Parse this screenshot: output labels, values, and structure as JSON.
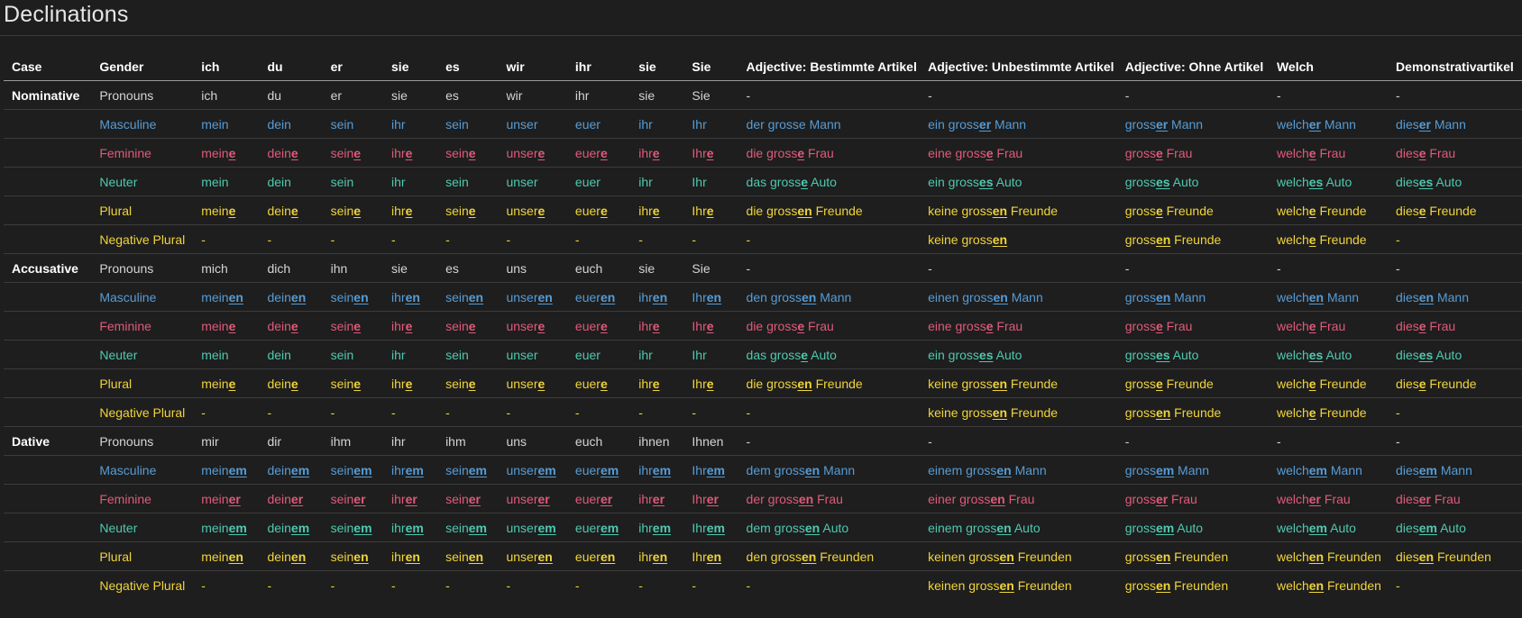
{
  "title": "Declinations",
  "colors": {
    "background": "#1e1e1e",
    "text": "#d4d4d4",
    "masculine": "#569cd6",
    "feminine": "#e05a7a",
    "neuter": "#4ec9b0",
    "plural": "#f0d43a"
  },
  "headers": [
    "Case",
    "Gender",
    "ich",
    "du",
    "er",
    "sie",
    "es",
    "wir",
    "ihr",
    "sie",
    "Sie",
    "Adjective: Bestimmte Artikel",
    "Adjective: Unbestimmte Artikel",
    "Adjective: Ohne Artikel",
    "Welch",
    "Demonstrativartikel"
  ],
  "rows": [
    {
      "case": "Nominative",
      "color": "none",
      "gender": "Pronouns",
      "cells": [
        "ich",
        "du",
        "er",
        "sie",
        "es",
        "wir",
        "ihr",
        "sie",
        "Sie",
        "-",
        "-",
        "-",
        "-",
        "-"
      ]
    },
    {
      "case": "",
      "color": "blue",
      "gender": "Masculine",
      "cells": [
        "mein",
        "dein",
        "sein",
        "ihr",
        "sein",
        "unser",
        "euer",
        "ihr",
        "Ihr",
        "der grosse Mann",
        "ein gross[er] Mann",
        "gross[er] Mann",
        "welch[er] Mann",
        "dies[er] Mann"
      ]
    },
    {
      "case": "",
      "color": "pink",
      "gender": "Feminine",
      "cells": [
        "mein[e]",
        "dein[e]",
        "sein[e]",
        "ihr[e]",
        "sein[e]",
        "unser[e]",
        "euer[e]",
        "ihr[e]",
        "Ihr[e]",
        "die gross[e] Frau",
        "eine gross[e] Frau",
        "gross[e] Frau",
        "welch[e] Frau",
        "dies[e] Frau"
      ]
    },
    {
      "case": "",
      "color": "teal",
      "gender": "Neuter",
      "cells": [
        "mein",
        "dein",
        "sein",
        "ihr",
        "sein",
        "unser",
        "euer",
        "ihr",
        "Ihr",
        "das gross[e] Auto",
        "ein gross[es] Auto",
        "gross[es] Auto",
        "welch[es] Auto",
        "dies[es] Auto"
      ]
    },
    {
      "case": "",
      "color": "yellow",
      "gender": "Plural",
      "cells": [
        "mein[e]",
        "dein[e]",
        "sein[e]",
        "ihr[e]",
        "sein[e]",
        "unser[e]",
        "euer[e]",
        "ihr[e]",
        "Ihr[e]",
        "die gross[en] Freunde",
        "keine gross[en] Freunde",
        "gross[e] Freunde",
        "welch[e] Freunde",
        "dies[e] Freunde"
      ]
    },
    {
      "case": "",
      "color": "yellow",
      "gender": "Negative Plural",
      "cells": [
        "-",
        "-",
        "-",
        "-",
        "-",
        "-",
        "-",
        "-",
        "-",
        "-",
        "keine gross[en]",
        "gross[en] Freunde",
        "welch[e] Freunde",
        "-"
      ]
    },
    {
      "case": "Accusative",
      "color": "none",
      "gender": "Pronouns",
      "cells": [
        "mich",
        "dich",
        "ihn",
        "sie",
        "es",
        "uns",
        "euch",
        "sie",
        "Sie",
        "-",
        "-",
        "-",
        "-",
        "-"
      ]
    },
    {
      "case": "",
      "color": "blue",
      "gender": "Masculine",
      "cells": [
        "mein[en]",
        "dein[en]",
        "sein[en]",
        "ihr[en]",
        "sein[en]",
        "unser[en]",
        "euer[en]",
        "ihr[en]",
        "Ihr[en]",
        "den gross[en] Mann",
        "einen gross[en] Mann",
        "gross[en] Mann",
        "welch[en] Mann",
        "dies[en] Mann"
      ]
    },
    {
      "case": "",
      "color": "pink",
      "gender": "Feminine",
      "cells": [
        "mein[e]",
        "dein[e]",
        "sein[e]",
        "ihr[e]",
        "sein[e]",
        "unser[e]",
        "euer[e]",
        "ihr[e]",
        "Ihr[e]",
        "die gross[e] Frau",
        "eine gross[e] Frau",
        "gross[e] Frau",
        "welch[e] Frau",
        "dies[e] Frau"
      ]
    },
    {
      "case": "",
      "color": "teal",
      "gender": "Neuter",
      "cells": [
        "mein",
        "dein",
        "sein",
        "ihr",
        "sein",
        "unser",
        "euer",
        "ihr",
        "Ihr",
        "das gross[e] Auto",
        "ein gross[es] Auto",
        "gross[es] Auto",
        "welch[es] Auto",
        "dies[es] Auto"
      ]
    },
    {
      "case": "",
      "color": "yellow",
      "gender": "Plural",
      "cells": [
        "mein[e]",
        "dein[e]",
        "sein[e]",
        "ihr[e]",
        "sein[e]",
        "unser[e]",
        "euer[e]",
        "ihr[e]",
        "Ihr[e]",
        "die gross[en] Freunde",
        "keine gross[en] Freunde",
        "gross[e] Freunde",
        "welch[e] Freunde",
        "dies[e] Freunde"
      ]
    },
    {
      "case": "",
      "color": "yellow",
      "gender": "Negative Plural",
      "cells": [
        "-",
        "-",
        "-",
        "-",
        "-",
        "-",
        "-",
        "-",
        "-",
        "-",
        "keine gross[en] Freunde",
        "gross[en] Freunde",
        "welch[e] Freunde",
        "-"
      ]
    },
    {
      "case": "Dative",
      "color": "none",
      "gender": "Pronouns",
      "cells": [
        "mir",
        "dir",
        "ihm",
        "ihr",
        "ihm",
        "uns",
        "euch",
        "ihnen",
        "Ihnen",
        "-",
        "-",
        "-",
        "-",
        "-"
      ]
    },
    {
      "case": "",
      "color": "blue",
      "gender": "Masculine",
      "cells": [
        "mein[em]",
        "dein[em]",
        "sein[em]",
        "ihr[em]",
        "sein[em]",
        "unser[em]",
        "euer[em]",
        "ihr[em]",
        "Ihr[em]",
        "dem gross[en] Mann",
        "einem gross[en] Mann",
        "gross[em] Mann",
        "welch[em] Mann",
        "dies[em] Mann"
      ]
    },
    {
      "case": "",
      "color": "pink",
      "gender": "Feminine",
      "cells": [
        "mein[er]",
        "dein[er]",
        "sein[er]",
        "ihr[er]",
        "sein[er]",
        "unser[er]",
        "euer[er]",
        "ihr[er]",
        "Ihr[er]",
        "der gross[en] Frau",
        "einer gross[en] Frau",
        "gross[er] Frau",
        "welch[er] Frau",
        "dies[er] Frau"
      ]
    },
    {
      "case": "",
      "color": "teal",
      "gender": "Neuter",
      "cells": [
        "mein[em]",
        "dein[em]",
        "sein[em]",
        "ihr[em]",
        "sein[em]",
        "unser[em]",
        "euer[em]",
        "ihr[em]",
        "Ihr[em]",
        "dem gross[en] Auto",
        "einem gross[en] Auto",
        "gross[em] Auto",
        "welch[em] Auto",
        "dies[em] Auto"
      ]
    },
    {
      "case": "",
      "color": "yellow",
      "gender": "Plural",
      "cells": [
        "mein[en]",
        "dein[en]",
        "sein[en]",
        "ihr[en]",
        "sein[en]",
        "unser[en]",
        "euer[en]",
        "ihr[en]",
        "Ihr[en]",
        "den gross[en] Freunden",
        "keinen gross[en] Freunden",
        "gross[en] Freunden",
        "welch[en] Freunden",
        "dies[en] Freunden"
      ]
    },
    {
      "case": "",
      "color": "yellow",
      "gender": "Negative Plural",
      "cells": [
        "-",
        "-",
        "-",
        "-",
        "-",
        "-",
        "-",
        "-",
        "-",
        "-",
        "keinen gross[en] Freunden",
        "gross[en] Freunden",
        "welch[en] Freunden",
        "-"
      ]
    }
  ]
}
